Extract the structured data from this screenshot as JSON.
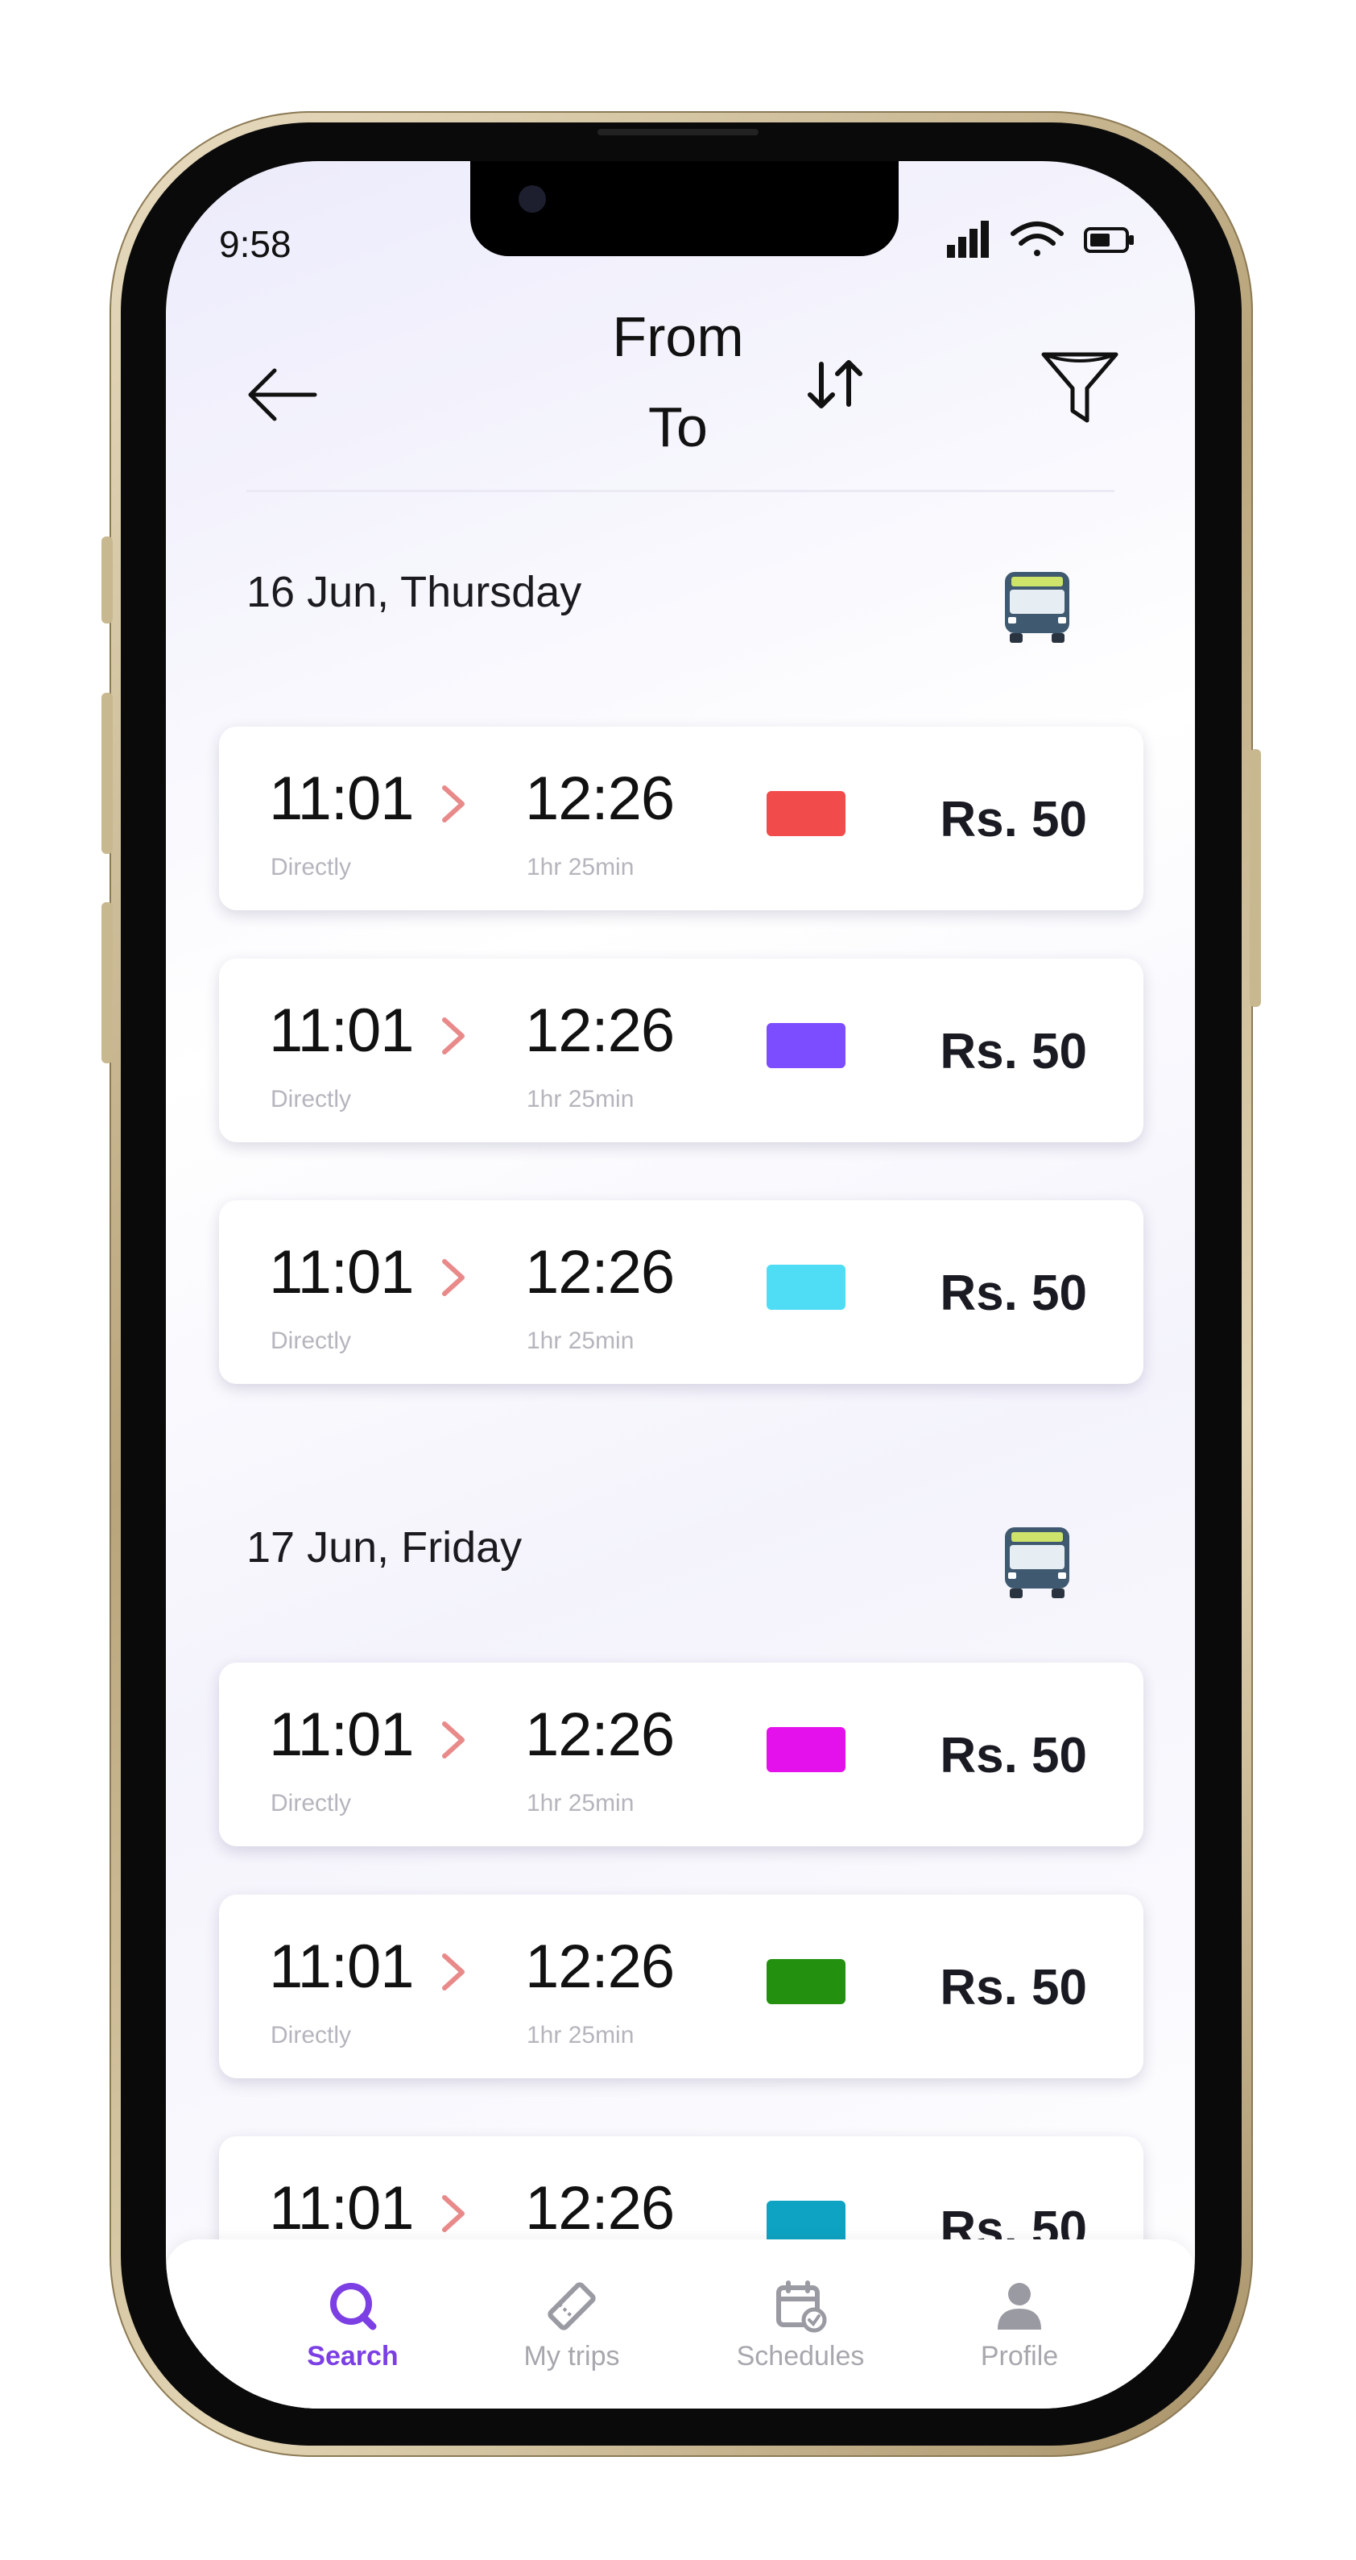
{
  "status_bar": {
    "time": "9:58"
  },
  "header": {
    "from": "From",
    "to": "To"
  },
  "sections": [
    {
      "date": "16 Jun, Thursday",
      "trips": [
        {
          "dep": "11:01",
          "arr": "12:26",
          "route": "Directly",
          "duration": "1hr 25min",
          "color": "#f24b4b",
          "price": "Rs. 50"
        },
        {
          "dep": "11:01",
          "arr": "12:26",
          "route": "Directly",
          "duration": "1hr 25min",
          "color": "#7c4cff",
          "price": "Rs. 50"
        },
        {
          "dep": "11:01",
          "arr": "12:26",
          "route": "Directly",
          "duration": "1hr 25min",
          "color": "#4fdcf5",
          "price": "Rs. 50"
        }
      ]
    },
    {
      "date": "17 Jun, Friday",
      "trips": [
        {
          "dep": "11:01",
          "arr": "12:26",
          "route": "Directly",
          "duration": "1hr 25min",
          "color": "#e511ec",
          "price": "Rs. 50"
        },
        {
          "dep": "11:01",
          "arr": "12:26",
          "route": "Directly",
          "duration": "1hr 25min",
          "color": "#239010",
          "price": "Rs. 50"
        },
        {
          "dep": "11:01",
          "arr": "12:26",
          "route": "",
          "duration": "",
          "color": "#0ea3c3",
          "price": "Rs. 50"
        }
      ]
    }
  ],
  "tabbar": {
    "items": [
      {
        "label": "Search",
        "icon": "search-icon",
        "active": true
      },
      {
        "label": "My trips",
        "icon": "ticket-icon",
        "active": false
      },
      {
        "label": "Schedules",
        "icon": "calendar-icon",
        "active": false
      },
      {
        "label": "Profile",
        "icon": "person-icon",
        "active": false
      }
    ]
  },
  "colors": {
    "accent": "#7b3fe4",
    "chevron": "#e98a8a"
  }
}
